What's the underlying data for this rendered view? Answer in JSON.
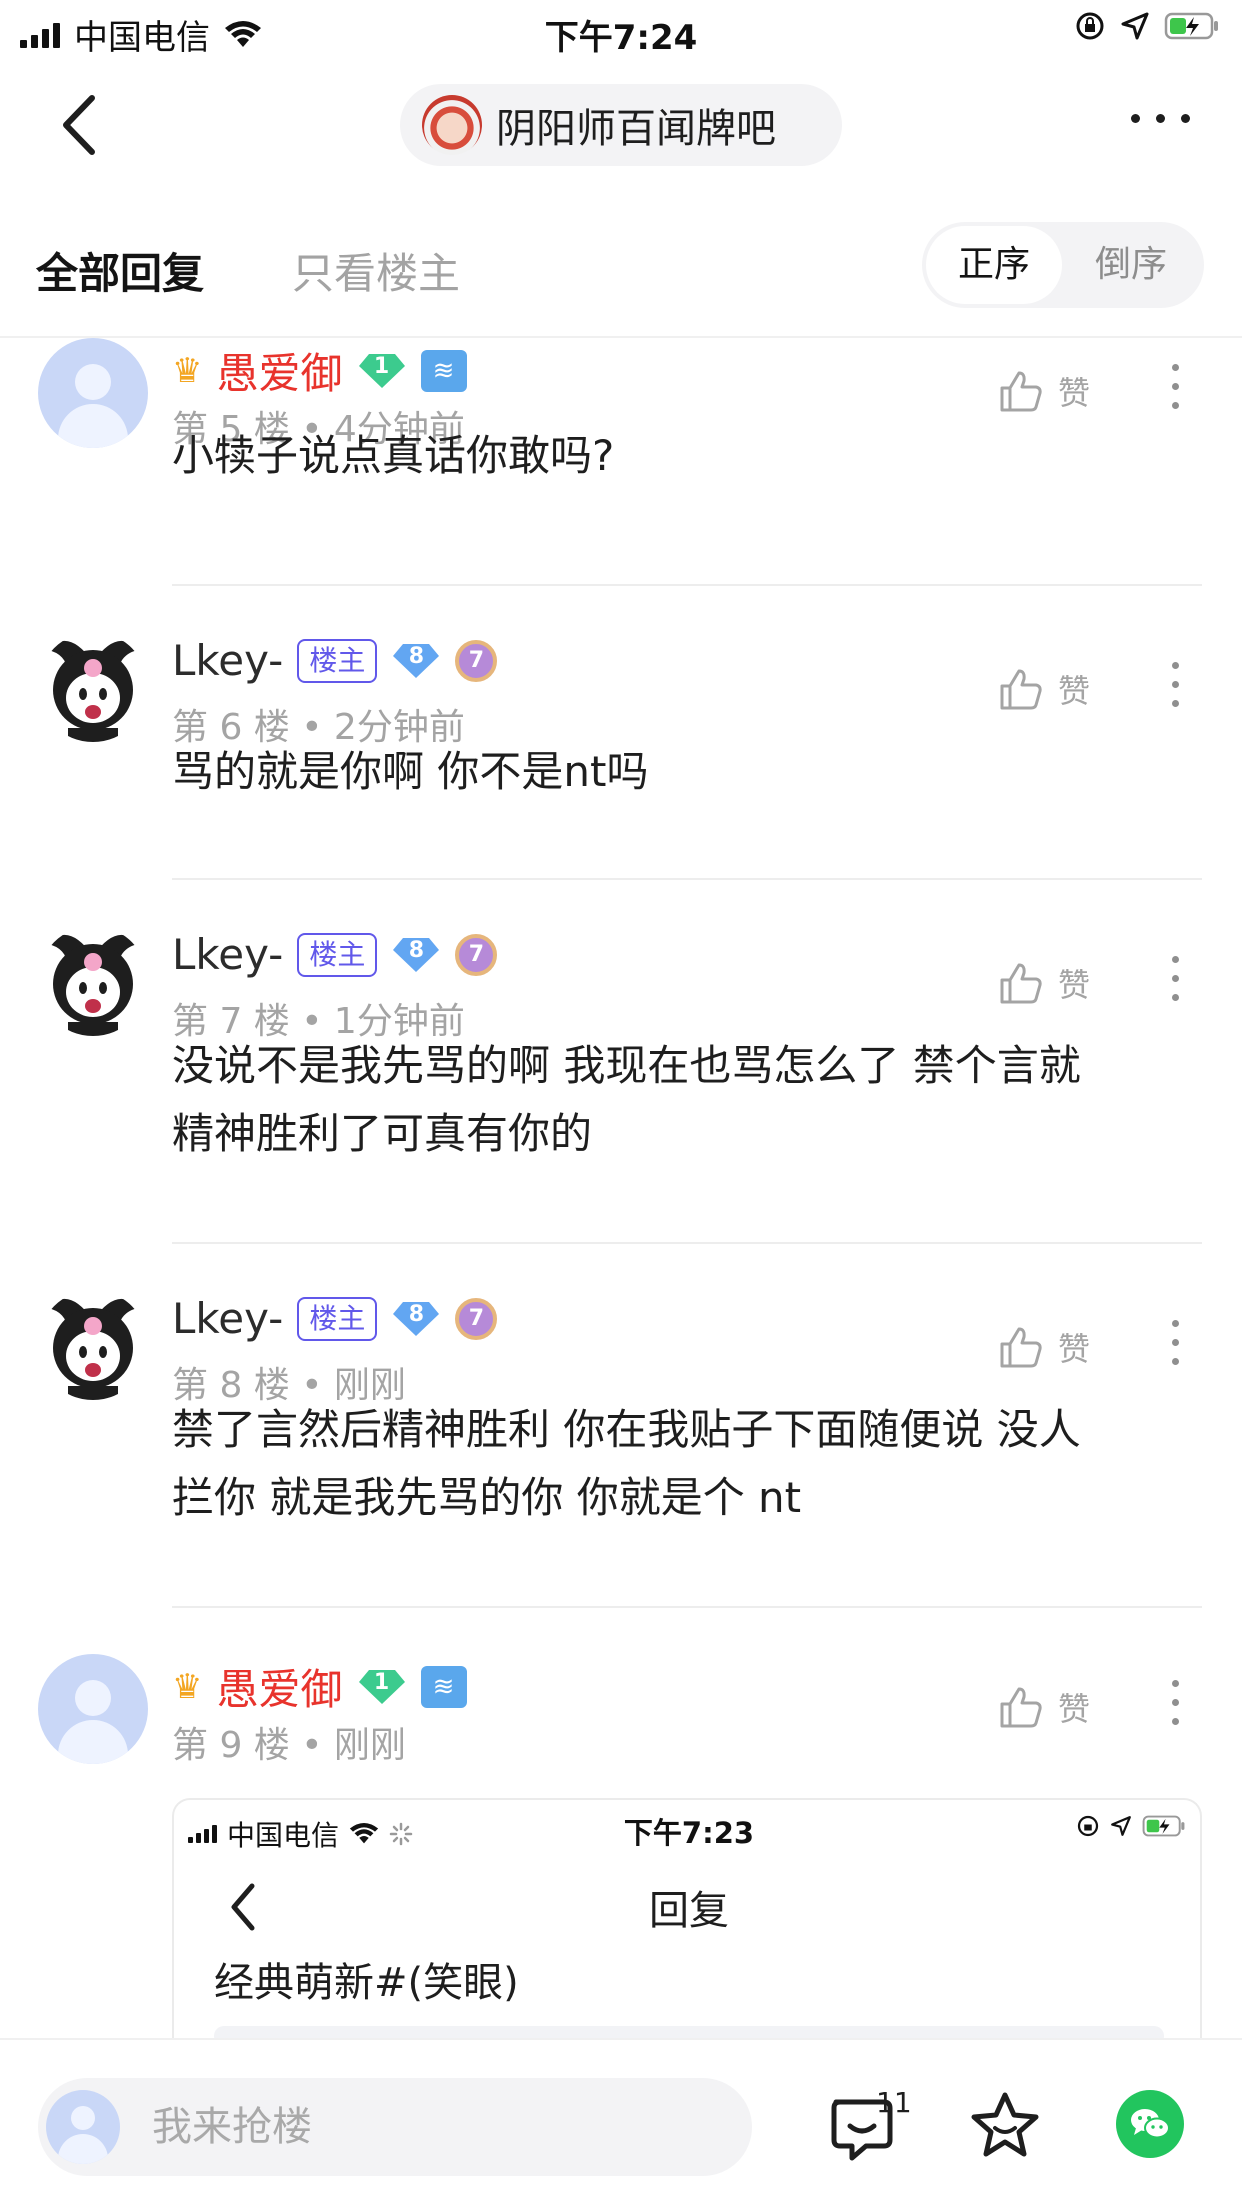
{
  "status_bar": {
    "carrier": "中国电信",
    "time": "下午7:24"
  },
  "nav": {
    "forum_name": "阴阳师百闻牌吧"
  },
  "tabs": {
    "all_replies": "全部回复",
    "only_op": "只看楼主",
    "sort_asc": "正序",
    "sort_desc": "倒序"
  },
  "posts": [
    {
      "username": "愚爱御",
      "gem_level": "1",
      "zodiac": "≋",
      "floor": "第 5 楼",
      "time": "4分钟前",
      "like_label": "赞",
      "content": "小犊子说点真话你敢吗?"
    },
    {
      "username": "Lkey-",
      "op_badge": "楼主",
      "gem_level": "8",
      "user_level": "7",
      "floor": "第 6 楼",
      "time": "2分钟前",
      "like_label": "赞",
      "content": "骂的就是你啊 你不是nt吗"
    },
    {
      "username": "Lkey-",
      "op_badge": "楼主",
      "gem_level": "8",
      "user_level": "7",
      "floor": "第 7 楼",
      "time": "1分钟前",
      "like_label": "赞",
      "content_line1": "没说不是我先骂的啊 我现在也骂怎么了 禁个言就",
      "content_line2": "精神胜利了可真有你的"
    },
    {
      "username": "Lkey-",
      "op_badge": "楼主",
      "gem_level": "8",
      "user_level": "7",
      "floor": "第 8 楼",
      "time": "刚刚",
      "like_label": "赞",
      "content_line1": "禁了言然后精神胜利 你在我贴子下面随便说 没人",
      "content_line2": "拦你 就是我先骂的你 你就是个 nt"
    },
    {
      "username": "愚爱御",
      "gem_level": "1",
      "zodiac": "≋",
      "floor": "第 9 楼",
      "time": "刚刚",
      "like_label": "赞"
    }
  ],
  "embedded_screenshot": {
    "carrier": "中国电信",
    "time": "下午7:23",
    "title": "回复",
    "text": "经典萌新#(笑眼)"
  },
  "bottom_bar": {
    "input_placeholder": "我来抢楼",
    "comment_count": "11"
  },
  "colors": {
    "vip_name": "#e8332c",
    "op_badge": "#6158ea",
    "wechat": "#22c55e",
    "muted_text": "#a4a4a4"
  },
  "icons": [
    "back-icon",
    "more-icon",
    "like-icon",
    "kebab-icon",
    "comment-icon",
    "star-icon",
    "wechat-icon",
    "wifi-icon",
    "battery-icon",
    "location-icon",
    "orientation-lock-icon"
  ]
}
